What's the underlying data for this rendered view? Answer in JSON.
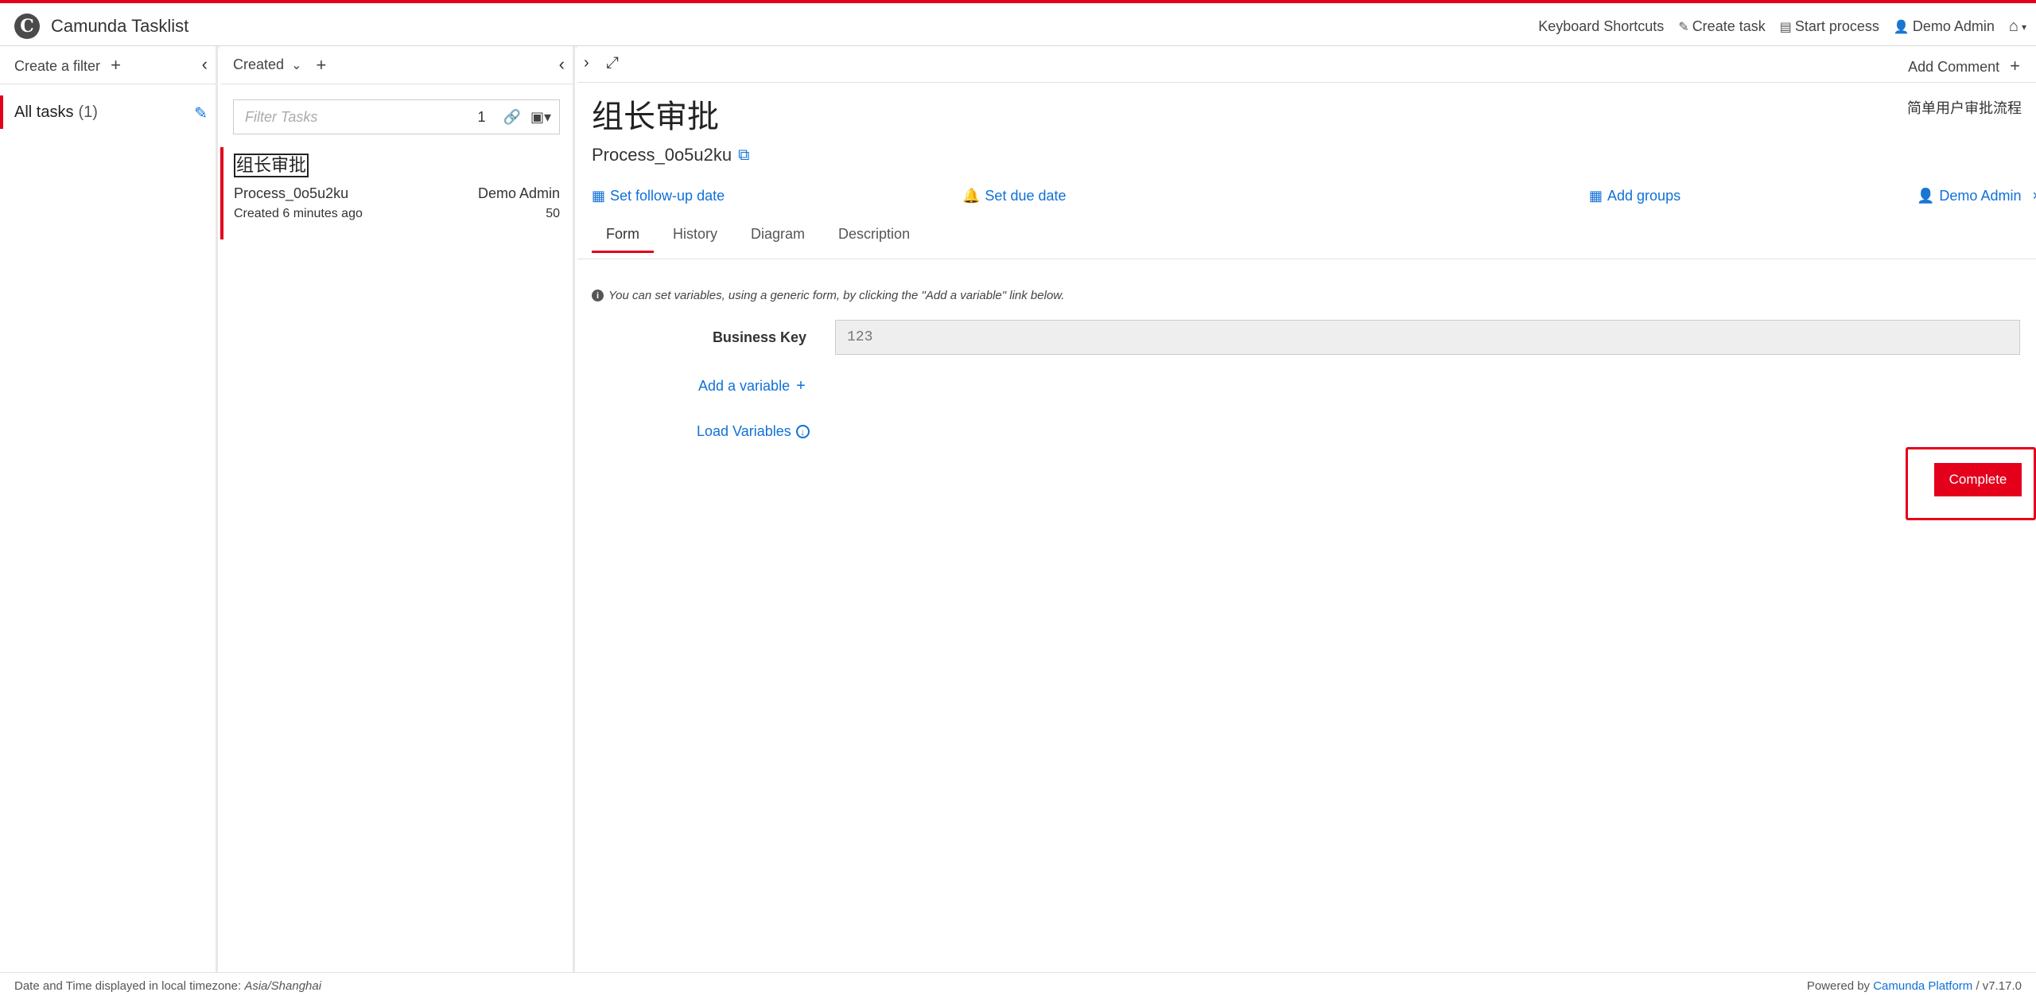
{
  "header": {
    "app_title": "Camunda Tasklist",
    "logo_letter": "C",
    "nav": {
      "keyboard_shortcuts": "Keyboard Shortcuts",
      "create_task": "Create task",
      "start_process": "Start process",
      "user": "Demo Admin"
    }
  },
  "filters": {
    "create_label": "Create a filter",
    "items": [
      {
        "label": "All tasks",
        "count": "(1)"
      }
    ]
  },
  "task_list": {
    "sort_label": "Created",
    "search": {
      "placeholder": "Filter Tasks",
      "count": "1"
    },
    "tasks": [
      {
        "name": "组长审批",
        "process": "Process_0o5u2ku",
        "assignee": "Demo Admin",
        "created": "Created 6 minutes ago",
        "priority": "50"
      }
    ]
  },
  "detail": {
    "add_comment": "Add Comment",
    "title": "组长审批",
    "process_definition": "简单用户审批流程",
    "process_name": "Process_0o5u2ku",
    "actions": {
      "follow_up": "Set follow-up date",
      "due_date": "Set due date",
      "add_groups": "Add groups",
      "assignee": "Demo Admin"
    },
    "tabs": [
      "Form",
      "History",
      "Diagram",
      "Description"
    ],
    "form": {
      "hint": "You can set variables, using a generic form, by clicking the \"Add a variable\" link below.",
      "business_key_label": "Business Key",
      "business_key_value": "123",
      "add_variable": "Add a variable",
      "load_variables": "Load Variables",
      "complete": "Complete"
    }
  },
  "footer": {
    "timezone_prefix": "Date and Time displayed in local timezone:",
    "timezone": "Asia/Shanghai",
    "powered_by": "Powered by",
    "platform": "Camunda Platform",
    "version": "/ v7.17.0"
  }
}
